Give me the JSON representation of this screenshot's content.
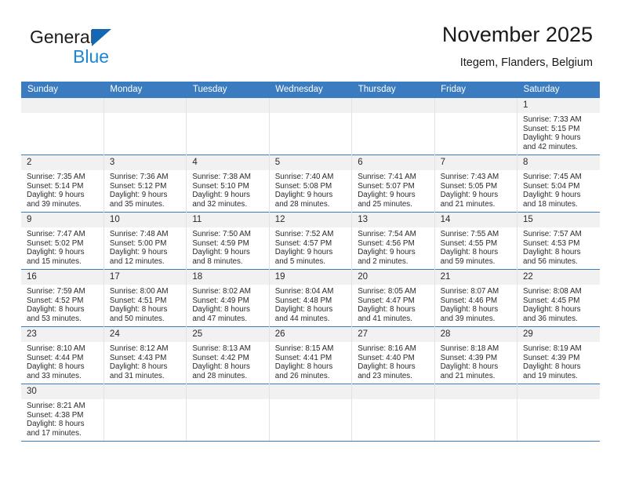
{
  "brand": {
    "name_part1": "General",
    "name_part2": "Blue",
    "logo_icon": "blue-triangle-logo",
    "accent_color": "#1c86d6",
    "triangle_color": "#1268b3"
  },
  "header": {
    "title": "November 2025",
    "subtitle": "Itegem, Flanders, Belgium"
  },
  "calendar": {
    "header_bg": "#3b7cc0",
    "daynum_bg": "#f1f1f1",
    "weekdays": [
      "Sunday",
      "Monday",
      "Tuesday",
      "Wednesday",
      "Thursday",
      "Friday",
      "Saturday"
    ],
    "weeks": [
      [
        {
          "day": "",
          "empty": true
        },
        {
          "day": "",
          "empty": true
        },
        {
          "day": "",
          "empty": true
        },
        {
          "day": "",
          "empty": true
        },
        {
          "day": "",
          "empty": true
        },
        {
          "day": "",
          "empty": true
        },
        {
          "day": "1",
          "sunrise": "Sunrise: 7:33 AM",
          "sunset": "Sunset: 5:15 PM",
          "daylight_line1": "Daylight: 9 hours",
          "daylight_line2": "and 42 minutes."
        }
      ],
      [
        {
          "day": "2",
          "sunrise": "Sunrise: 7:35 AM",
          "sunset": "Sunset: 5:14 PM",
          "daylight_line1": "Daylight: 9 hours",
          "daylight_line2": "and 39 minutes."
        },
        {
          "day": "3",
          "sunrise": "Sunrise: 7:36 AM",
          "sunset": "Sunset: 5:12 PM",
          "daylight_line1": "Daylight: 9 hours",
          "daylight_line2": "and 35 minutes."
        },
        {
          "day": "4",
          "sunrise": "Sunrise: 7:38 AM",
          "sunset": "Sunset: 5:10 PM",
          "daylight_line1": "Daylight: 9 hours",
          "daylight_line2": "and 32 minutes."
        },
        {
          "day": "5",
          "sunrise": "Sunrise: 7:40 AM",
          "sunset": "Sunset: 5:08 PM",
          "daylight_line1": "Daylight: 9 hours",
          "daylight_line2": "and 28 minutes."
        },
        {
          "day": "6",
          "sunrise": "Sunrise: 7:41 AM",
          "sunset": "Sunset: 5:07 PM",
          "daylight_line1": "Daylight: 9 hours",
          "daylight_line2": "and 25 minutes."
        },
        {
          "day": "7",
          "sunrise": "Sunrise: 7:43 AM",
          "sunset": "Sunset: 5:05 PM",
          "daylight_line1": "Daylight: 9 hours",
          "daylight_line2": "and 21 minutes."
        },
        {
          "day": "8",
          "sunrise": "Sunrise: 7:45 AM",
          "sunset": "Sunset: 5:04 PM",
          "daylight_line1": "Daylight: 9 hours",
          "daylight_line2": "and 18 minutes."
        }
      ],
      [
        {
          "day": "9",
          "sunrise": "Sunrise: 7:47 AM",
          "sunset": "Sunset: 5:02 PM",
          "daylight_line1": "Daylight: 9 hours",
          "daylight_line2": "and 15 minutes."
        },
        {
          "day": "10",
          "sunrise": "Sunrise: 7:48 AM",
          "sunset": "Sunset: 5:00 PM",
          "daylight_line1": "Daylight: 9 hours",
          "daylight_line2": "and 12 minutes."
        },
        {
          "day": "11",
          "sunrise": "Sunrise: 7:50 AM",
          "sunset": "Sunset: 4:59 PM",
          "daylight_line1": "Daylight: 9 hours",
          "daylight_line2": "and 8 minutes."
        },
        {
          "day": "12",
          "sunrise": "Sunrise: 7:52 AM",
          "sunset": "Sunset: 4:57 PM",
          "daylight_line1": "Daylight: 9 hours",
          "daylight_line2": "and 5 minutes."
        },
        {
          "day": "13",
          "sunrise": "Sunrise: 7:54 AM",
          "sunset": "Sunset: 4:56 PM",
          "daylight_line1": "Daylight: 9 hours",
          "daylight_line2": "and 2 minutes."
        },
        {
          "day": "14",
          "sunrise": "Sunrise: 7:55 AM",
          "sunset": "Sunset: 4:55 PM",
          "daylight_line1": "Daylight: 8 hours",
          "daylight_line2": "and 59 minutes."
        },
        {
          "day": "15",
          "sunrise": "Sunrise: 7:57 AM",
          "sunset": "Sunset: 4:53 PM",
          "daylight_line1": "Daylight: 8 hours",
          "daylight_line2": "and 56 minutes."
        }
      ],
      [
        {
          "day": "16",
          "sunrise": "Sunrise: 7:59 AM",
          "sunset": "Sunset: 4:52 PM",
          "daylight_line1": "Daylight: 8 hours",
          "daylight_line2": "and 53 minutes."
        },
        {
          "day": "17",
          "sunrise": "Sunrise: 8:00 AM",
          "sunset": "Sunset: 4:51 PM",
          "daylight_line1": "Daylight: 8 hours",
          "daylight_line2": "and 50 minutes."
        },
        {
          "day": "18",
          "sunrise": "Sunrise: 8:02 AM",
          "sunset": "Sunset: 4:49 PM",
          "daylight_line1": "Daylight: 8 hours",
          "daylight_line2": "and 47 minutes."
        },
        {
          "day": "19",
          "sunrise": "Sunrise: 8:04 AM",
          "sunset": "Sunset: 4:48 PM",
          "daylight_line1": "Daylight: 8 hours",
          "daylight_line2": "and 44 minutes."
        },
        {
          "day": "20",
          "sunrise": "Sunrise: 8:05 AM",
          "sunset": "Sunset: 4:47 PM",
          "daylight_line1": "Daylight: 8 hours",
          "daylight_line2": "and 41 minutes."
        },
        {
          "day": "21",
          "sunrise": "Sunrise: 8:07 AM",
          "sunset": "Sunset: 4:46 PM",
          "daylight_line1": "Daylight: 8 hours",
          "daylight_line2": "and 39 minutes."
        },
        {
          "day": "22",
          "sunrise": "Sunrise: 8:08 AM",
          "sunset": "Sunset: 4:45 PM",
          "daylight_line1": "Daylight: 8 hours",
          "daylight_line2": "and 36 minutes."
        }
      ],
      [
        {
          "day": "23",
          "sunrise": "Sunrise: 8:10 AM",
          "sunset": "Sunset: 4:44 PM",
          "daylight_line1": "Daylight: 8 hours",
          "daylight_line2": "and 33 minutes."
        },
        {
          "day": "24",
          "sunrise": "Sunrise: 8:12 AM",
          "sunset": "Sunset: 4:43 PM",
          "daylight_line1": "Daylight: 8 hours",
          "daylight_line2": "and 31 minutes."
        },
        {
          "day": "25",
          "sunrise": "Sunrise: 8:13 AM",
          "sunset": "Sunset: 4:42 PM",
          "daylight_line1": "Daylight: 8 hours",
          "daylight_line2": "and 28 minutes."
        },
        {
          "day": "26",
          "sunrise": "Sunrise: 8:15 AM",
          "sunset": "Sunset: 4:41 PM",
          "daylight_line1": "Daylight: 8 hours",
          "daylight_line2": "and 26 minutes."
        },
        {
          "day": "27",
          "sunrise": "Sunrise: 8:16 AM",
          "sunset": "Sunset: 4:40 PM",
          "daylight_line1": "Daylight: 8 hours",
          "daylight_line2": "and 23 minutes."
        },
        {
          "day": "28",
          "sunrise": "Sunrise: 8:18 AM",
          "sunset": "Sunset: 4:39 PM",
          "daylight_line1": "Daylight: 8 hours",
          "daylight_line2": "and 21 minutes."
        },
        {
          "day": "29",
          "sunrise": "Sunrise: 8:19 AM",
          "sunset": "Sunset: 4:39 PM",
          "daylight_line1": "Daylight: 8 hours",
          "daylight_line2": "and 19 minutes."
        }
      ],
      [
        {
          "day": "30",
          "sunrise": "Sunrise: 8:21 AM",
          "sunset": "Sunset: 4:38 PM",
          "daylight_line1": "Daylight: 8 hours",
          "daylight_line2": "and 17 minutes."
        },
        {
          "day": "",
          "empty": true
        },
        {
          "day": "",
          "empty": true
        },
        {
          "day": "",
          "empty": true
        },
        {
          "day": "",
          "empty": true
        },
        {
          "day": "",
          "empty": true
        },
        {
          "day": "",
          "empty": true
        }
      ]
    ]
  }
}
